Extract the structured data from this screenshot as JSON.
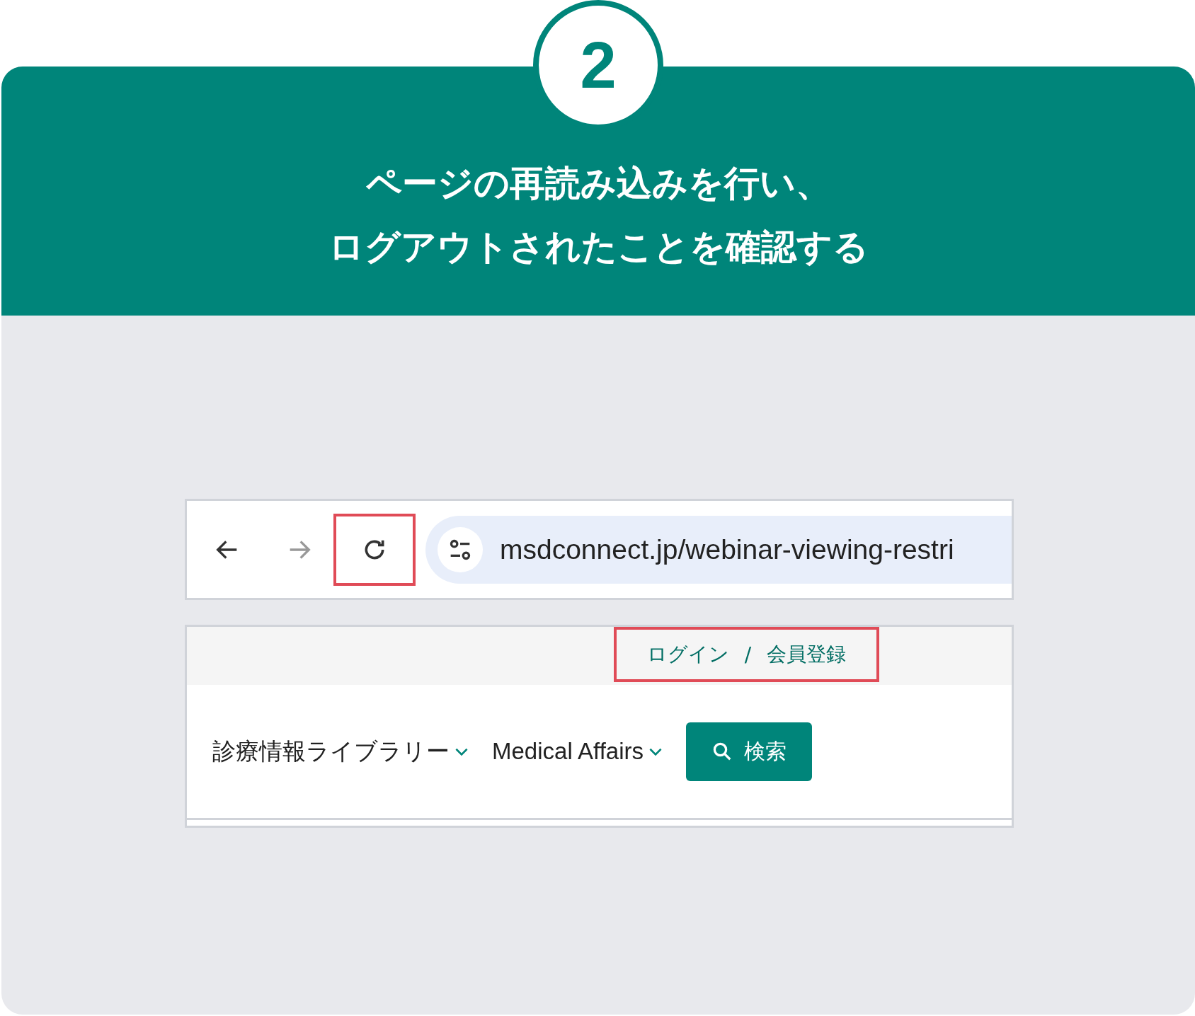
{
  "step": {
    "number": "2",
    "title_lines": [
      "ページの再読み込みを行い、",
      "ログアウトされたことを確認する"
    ]
  },
  "browser": {
    "buttons": [
      {
        "kind": "back",
        "disabled": false,
        "highlighted": false
      },
      {
        "kind": "forward",
        "disabled": true,
        "highlighted": false
      },
      {
        "kind": "reload",
        "disabled": false,
        "highlighted": true
      }
    ],
    "url": "msdconnect.jp/webinar-viewing-restri"
  },
  "site": {
    "account_links": {
      "highlighted": true,
      "login": "ログイン",
      "separator": "/",
      "register": "会員登録"
    },
    "nav_items": [
      {
        "label": "診療情報ライブラリー"
      },
      {
        "label": "Medical Affairs"
      }
    ],
    "search_button": "検索"
  }
}
